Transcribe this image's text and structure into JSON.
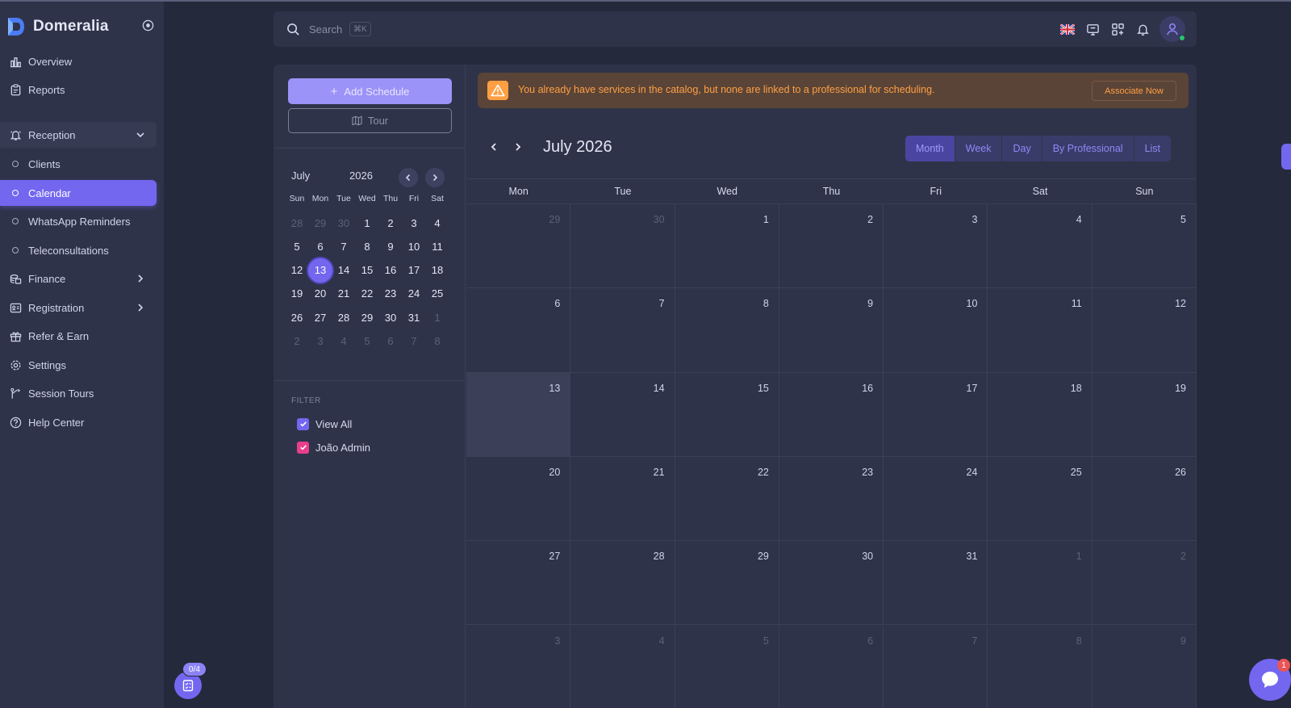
{
  "app": {
    "name": "Domeralia"
  },
  "sidebar": {
    "items": [
      {
        "id": "overview",
        "label": "Overview",
        "icon": "chart-bar-icon"
      },
      {
        "id": "reports",
        "label": "Reports",
        "icon": "clipboard-icon"
      },
      {
        "id": "reception",
        "label": "Reception",
        "icon": "bell-ring-icon"
      },
      {
        "id": "clients",
        "label": "Clients"
      },
      {
        "id": "calendar",
        "label": "Calendar"
      },
      {
        "id": "whatsapp-reminders",
        "label": "WhatsApp Reminders"
      },
      {
        "id": "teleconsultations",
        "label": "Teleconsultations"
      },
      {
        "id": "finance",
        "label": "Finance",
        "icon": "coins-icon"
      },
      {
        "id": "registration",
        "label": "Registration",
        "icon": "id-card-icon"
      },
      {
        "id": "refer-earn",
        "label": "Refer & Earn",
        "icon": "gift-icon"
      },
      {
        "id": "settings",
        "label": "Settings",
        "icon": "gear-icon"
      },
      {
        "id": "session-tours",
        "label": "Session Tours",
        "icon": "route-icon"
      },
      {
        "id": "help-center",
        "label": "Help Center",
        "icon": "help-circle-icon"
      }
    ],
    "active": "calendar",
    "tour_progress": "0/4"
  },
  "navbar": {
    "search_placeholder": "Search",
    "search_shortcut": "⌘K"
  },
  "left_panel": {
    "add_button": "Add Schedule",
    "tour_button": "Tour",
    "mini_calendar": {
      "month": "July",
      "year": "2026",
      "weekdays": [
        "Sun",
        "Mon",
        "Tue",
        "Wed",
        "Thu",
        "Fri",
        "Sat"
      ],
      "weeks": [
        [
          "28",
          "29",
          "30",
          "1",
          "2",
          "3",
          "4"
        ],
        [
          "5",
          "6",
          "7",
          "8",
          "9",
          "10",
          "11"
        ],
        [
          "12",
          "13",
          "14",
          "15",
          "16",
          "17",
          "18"
        ],
        [
          "19",
          "20",
          "21",
          "22",
          "23",
          "24",
          "25"
        ],
        [
          "26",
          "27",
          "28",
          "29",
          "30",
          "31",
          "1"
        ],
        [
          "2",
          "3",
          "4",
          "5",
          "6",
          "7",
          "8"
        ]
      ],
      "today": "13"
    },
    "filter": {
      "title": "FILTER",
      "items": [
        {
          "label": "View All",
          "color": "#7367f0"
        },
        {
          "label": "João Admin",
          "color": "#e83e8c"
        }
      ]
    }
  },
  "alert": {
    "message": "You already have services in the catalog, but none are linked to a professional for scheduling.",
    "action": "Associate Now"
  },
  "calendar": {
    "title": "July 2026",
    "views": [
      "Month",
      "Week",
      "Day",
      "By Professional",
      "List"
    ],
    "active_view": "Month",
    "weekdays": [
      "Mon",
      "Tue",
      "Wed",
      "Thu",
      "Fri",
      "Sat",
      "Sun"
    ],
    "weeks": [
      [
        "29",
        "30",
        "1",
        "2",
        "3",
        "4",
        "5"
      ],
      [
        "6",
        "7",
        "8",
        "9",
        "10",
        "11",
        "12"
      ],
      [
        "13",
        "14",
        "15",
        "16",
        "17",
        "18",
        "19"
      ],
      [
        "20",
        "21",
        "22",
        "23",
        "24",
        "25",
        "26"
      ],
      [
        "27",
        "28",
        "29",
        "30",
        "31",
        "1",
        "2"
      ],
      [
        "3",
        "4",
        "5",
        "6",
        "7",
        "8",
        "9"
      ]
    ],
    "today": "13"
  },
  "chat": {
    "unread": "1"
  },
  "colors": {
    "accent": "#7367f0",
    "warning": "#ff9f43",
    "sidebar_bg": "#2f3349",
    "page_bg": "#25293c"
  }
}
